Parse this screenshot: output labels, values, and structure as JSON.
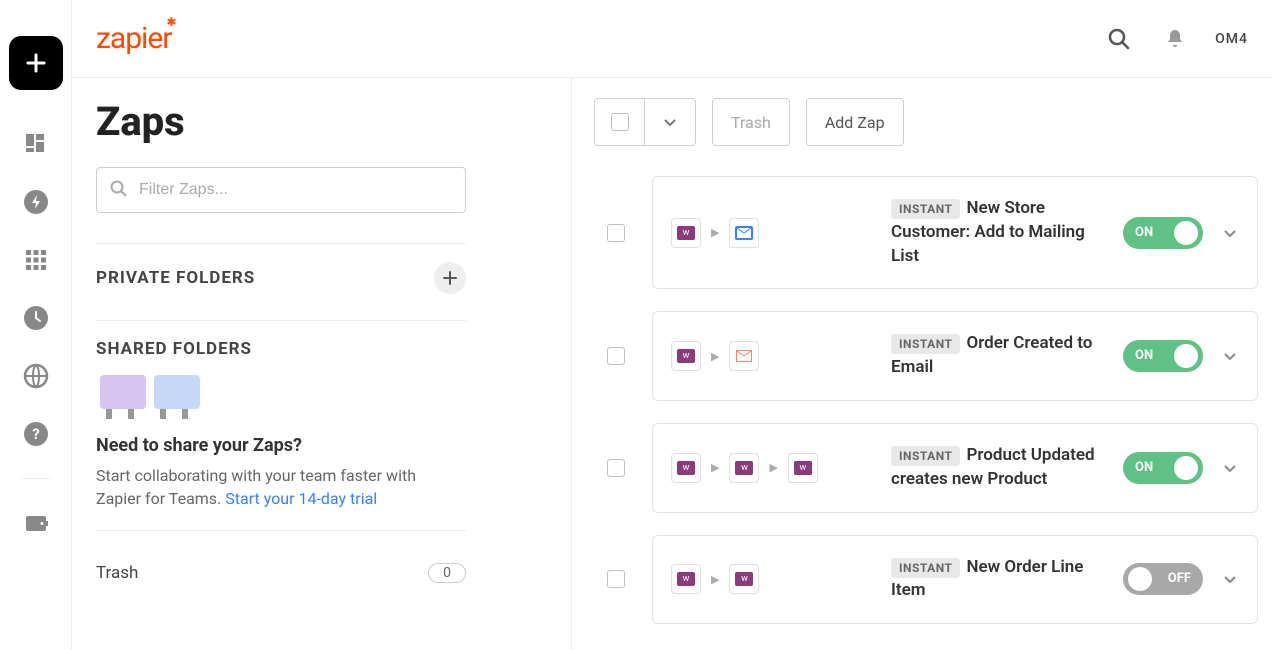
{
  "brand": "zapier",
  "header": {
    "avatar": "OM4"
  },
  "page": {
    "title": "Zaps",
    "filter_placeholder": "Filter Zaps..."
  },
  "folders": {
    "private_title": "PRIVATE FOLDERS",
    "shared_title": "SHARED FOLDERS",
    "share_heading": "Need to share your Zaps?",
    "share_text": "Start collaborating with your team faster with Zapier for Teams. ",
    "share_link": "Start your 14-day trial",
    "trash_label": "Trash",
    "trash_count": "0"
  },
  "toolbar": {
    "trash_label": "Trash",
    "add_label": "Add Zap"
  },
  "badge_instant": "INSTANT",
  "toggle": {
    "on": "ON",
    "off": "OFF"
  },
  "zaps": [
    {
      "title": "New Store Customer: Add to Mailing List",
      "on": true,
      "apps": [
        {
          "bg": "#8b3a7a",
          "glyph": "woo"
        },
        {
          "bg": "#3b82f6",
          "glyph": "mail-solid"
        }
      ]
    },
    {
      "title": "Order Created to Email",
      "on": true,
      "apps": [
        {
          "bg": "#8b3a7a",
          "glyph": "woo"
        },
        {
          "bg": "#ffffff",
          "glyph": "mail-outline",
          "stroke": "#f0886a"
        }
      ]
    },
    {
      "title": "Product Updated creates new Product",
      "on": true,
      "apps": [
        {
          "bg": "#8b3a7a",
          "glyph": "woo"
        },
        {
          "bg": "#8b3a7a",
          "glyph": "woo"
        },
        {
          "bg": "#8b3a7a",
          "glyph": "woo"
        }
      ]
    },
    {
      "title": "New Order Line Item",
      "on": false,
      "apps": [
        {
          "bg": "#8b3a7a",
          "glyph": "woo"
        },
        {
          "bg": "#8b3a7a",
          "glyph": "woo"
        }
      ]
    }
  ]
}
